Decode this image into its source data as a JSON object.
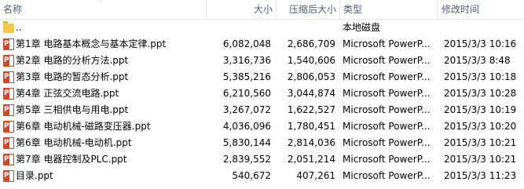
{
  "header": {
    "name": "名称",
    "size": "大小",
    "compressed": "压缩后大小",
    "type": "类型",
    "modified": "修改时间"
  },
  "parent": {
    "name": "..",
    "type": "本地磁盘"
  },
  "files": [
    {
      "name": "第1章 电路基本概念与基本定律.ppt",
      "size": "6,082,048",
      "compressed": "2,686,709",
      "type": "Microsoft PowerP...",
      "date": "2015/3/3 10:16"
    },
    {
      "name": "第2章 电路的分析方法.ppt",
      "size": "3,316,736",
      "compressed": "1,540,606",
      "type": "Microsoft PowerP...",
      "date": "2015/3/3 8:48"
    },
    {
      "name": "第3章 电路的暂态分析.ppt",
      "size": "5,385,216",
      "compressed": "2,806,053",
      "type": "Microsoft PowerP...",
      "date": "2015/3/3 10:18"
    },
    {
      "name": "第4章 正弦交流电路.ppt",
      "size": "6,210,560",
      "compressed": "3,044,874",
      "type": "Microsoft PowerP...",
      "date": "2015/3/3 10:28"
    },
    {
      "name": "第5章 三相供电与用电.ppt",
      "size": "3,267,072",
      "compressed": "1,622,527",
      "type": "Microsoft PowerP...",
      "date": "2015/3/3 10:19"
    },
    {
      "name": "第6章 电动机械-磁路变压器.ppt",
      "size": "4,036,096",
      "compressed": "1,780,451",
      "type": "Microsoft PowerP...",
      "date": "2015/3/3 10:20"
    },
    {
      "name": "第6章 电动机械-电动机.ppt",
      "size": "5,830,144",
      "compressed": "2,814,036",
      "type": "Microsoft PowerP...",
      "date": "2015/3/3 10:21"
    },
    {
      "name": "第7章 电器控制及PLC.ppt",
      "size": "2,839,552",
      "compressed": "2,051,214",
      "type": "Microsoft PowerP...",
      "date": "2015/3/3 10:21"
    },
    {
      "name": "目录.ppt",
      "size": "540,672",
      "compressed": "407,261",
      "type": "Microsoft PowerP...",
      "date": "2015/3/3 11:23"
    }
  ]
}
